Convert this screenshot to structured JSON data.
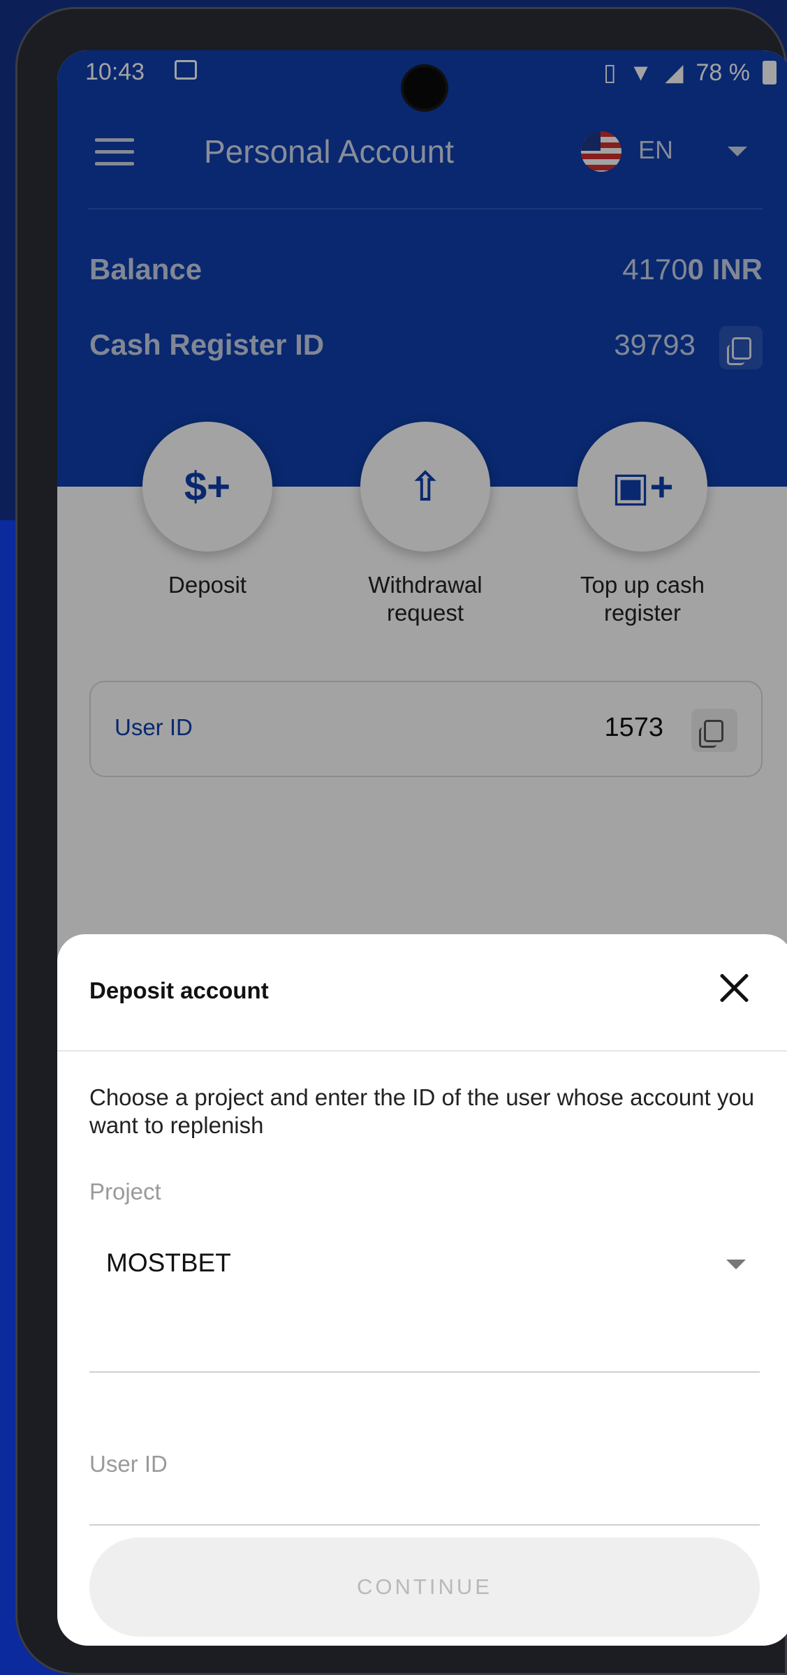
{
  "status_bar": {
    "time": "10:43",
    "battery": "78 %"
  },
  "header": {
    "title": "Personal Account",
    "language": "EN"
  },
  "account": {
    "balance_label": "Balance",
    "balance_value_light": "4170",
    "balance_value_bold": "0 INR",
    "cash_register_label": "Cash Register ID",
    "cash_register_value": "39793"
  },
  "actions": [
    {
      "label": "Deposit"
    },
    {
      "label": "Withdrawal request"
    },
    {
      "label": "Top up cash register"
    }
  ],
  "user_card": {
    "label": "User ID",
    "value": "1573"
  },
  "modal": {
    "title": "Deposit account",
    "description": "Choose a project and enter the ID of the user whose account you want to replenish",
    "project_label": "Project",
    "project_value": "MOSTBET",
    "user_id_placeholder": "User ID",
    "continue_label": "CONTINUE"
  },
  "colors": {
    "brand_blue": "#0f3fae",
    "overlay": "rgba(0,0,0,0.36)",
    "disabled_text": "#b9b9b9"
  }
}
